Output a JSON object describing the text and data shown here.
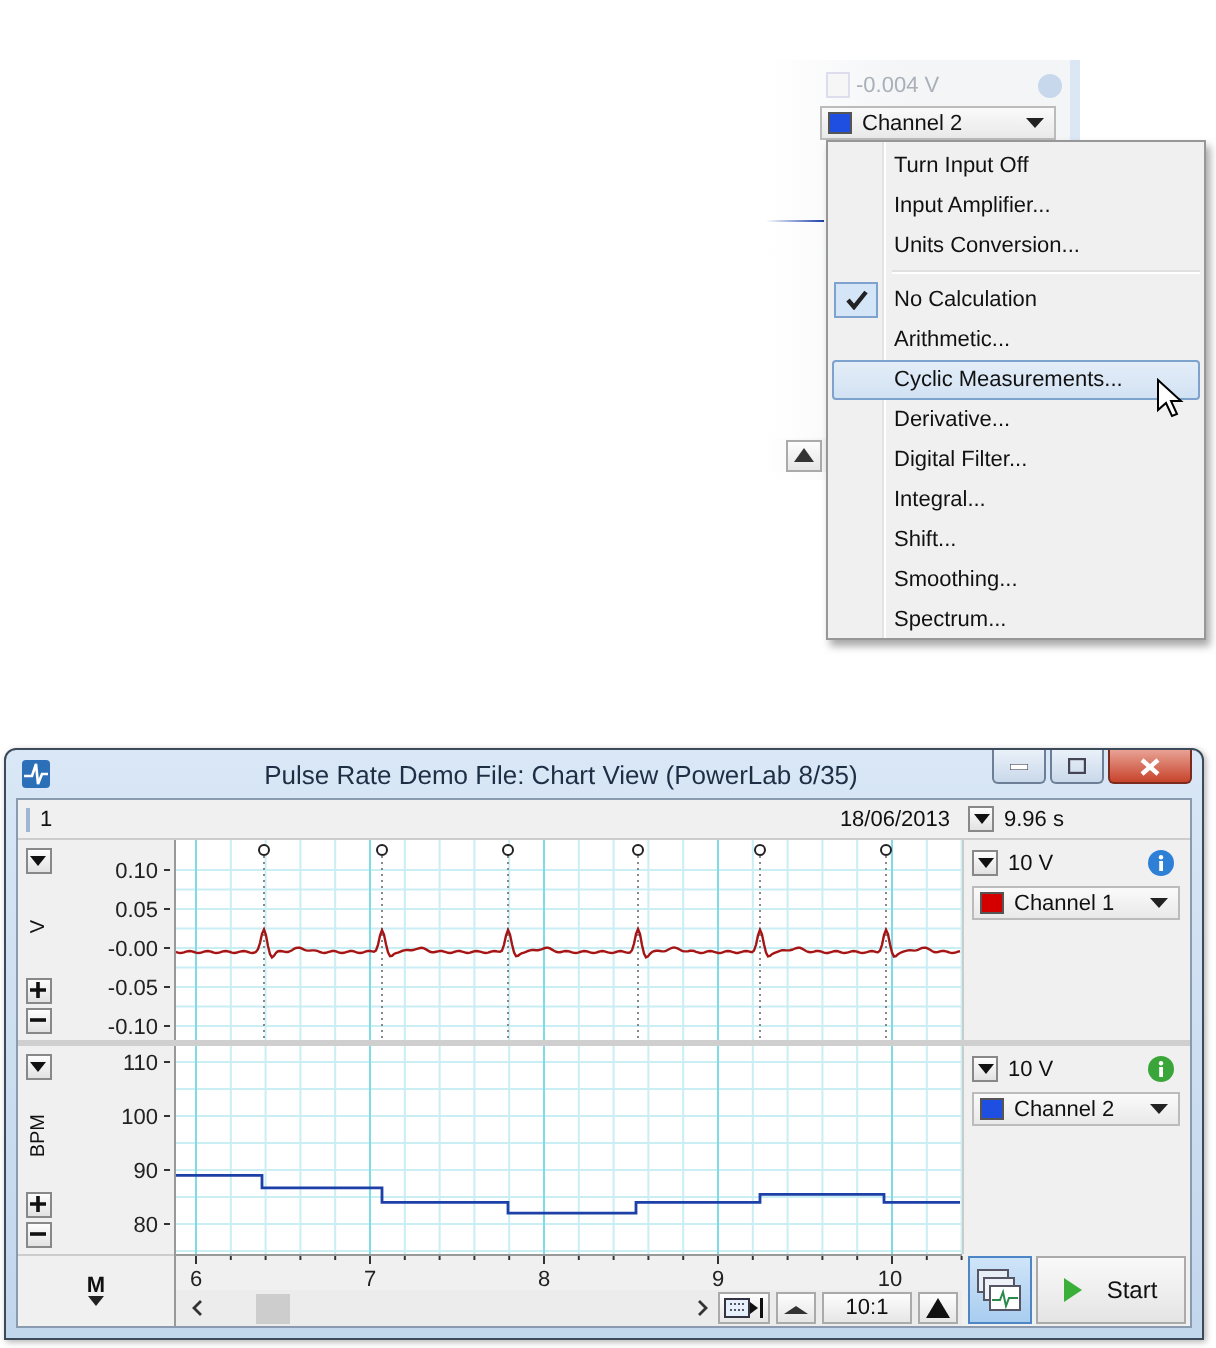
{
  "background_window": {
    "reading": "-0.004 V",
    "channel_name": "Channel 2",
    "color": "#1f4fe0"
  },
  "context_menu": {
    "items": [
      {
        "kind": "item",
        "label": "Turn Input Off",
        "checked": false,
        "selected": false
      },
      {
        "kind": "item",
        "label": "Input Amplifier...",
        "checked": false,
        "selected": false
      },
      {
        "kind": "item",
        "label": "Units Conversion...",
        "checked": false,
        "selected": false
      },
      {
        "kind": "separator"
      },
      {
        "kind": "item",
        "label": "No Calculation",
        "checked": true,
        "selected": false
      },
      {
        "kind": "item",
        "label": "Arithmetic...",
        "checked": false,
        "selected": false
      },
      {
        "kind": "item",
        "label": "Cyclic Measurements...",
        "checked": false,
        "selected": true
      },
      {
        "kind": "item",
        "label": "Derivative...",
        "checked": false,
        "selected": false
      },
      {
        "kind": "item",
        "label": "Digital Filter...",
        "checked": false,
        "selected": false
      },
      {
        "kind": "item",
        "label": "Integral...",
        "checked": false,
        "selected": false
      },
      {
        "kind": "item",
        "label": "Shift...",
        "checked": false,
        "selected": false
      },
      {
        "kind": "item",
        "label": "Smoothing...",
        "checked": false,
        "selected": false
      },
      {
        "kind": "item",
        "label": "Spectrum...",
        "checked": false,
        "selected": false
      }
    ]
  },
  "window": {
    "title": "Pulse Rate Demo File: Chart View (PowerLab 8/35)"
  },
  "toolbar": {
    "block": "1",
    "date": "18/06/2013",
    "duration": "9.96 s"
  },
  "channels": [
    {
      "unit": "V",
      "range": "10 V",
      "info": {
        "color": "#2e7fd6"
      },
      "name": "Channel 1",
      "color": "#d40000",
      "y_ticks": [
        "0.10",
        "0.05",
        "-0.00",
        "-0.05",
        "-0.10"
      ]
    },
    {
      "unit": "BPM",
      "range": "10 V",
      "info": {
        "color": "#3aa63a"
      },
      "name": "Channel 2",
      "color": "#1f4fe0",
      "y_ticks": [
        "110",
        "100",
        "90",
        "80"
      ]
    }
  ],
  "x_ticks": [
    "6",
    "7",
    "8",
    "9",
    "10"
  ],
  "scroll_bar": {
    "zoom": "10:1"
  },
  "marker": {
    "label": "M"
  },
  "view_toggle": {
    "selected": true
  },
  "start_button": {
    "label": "Start"
  }
}
